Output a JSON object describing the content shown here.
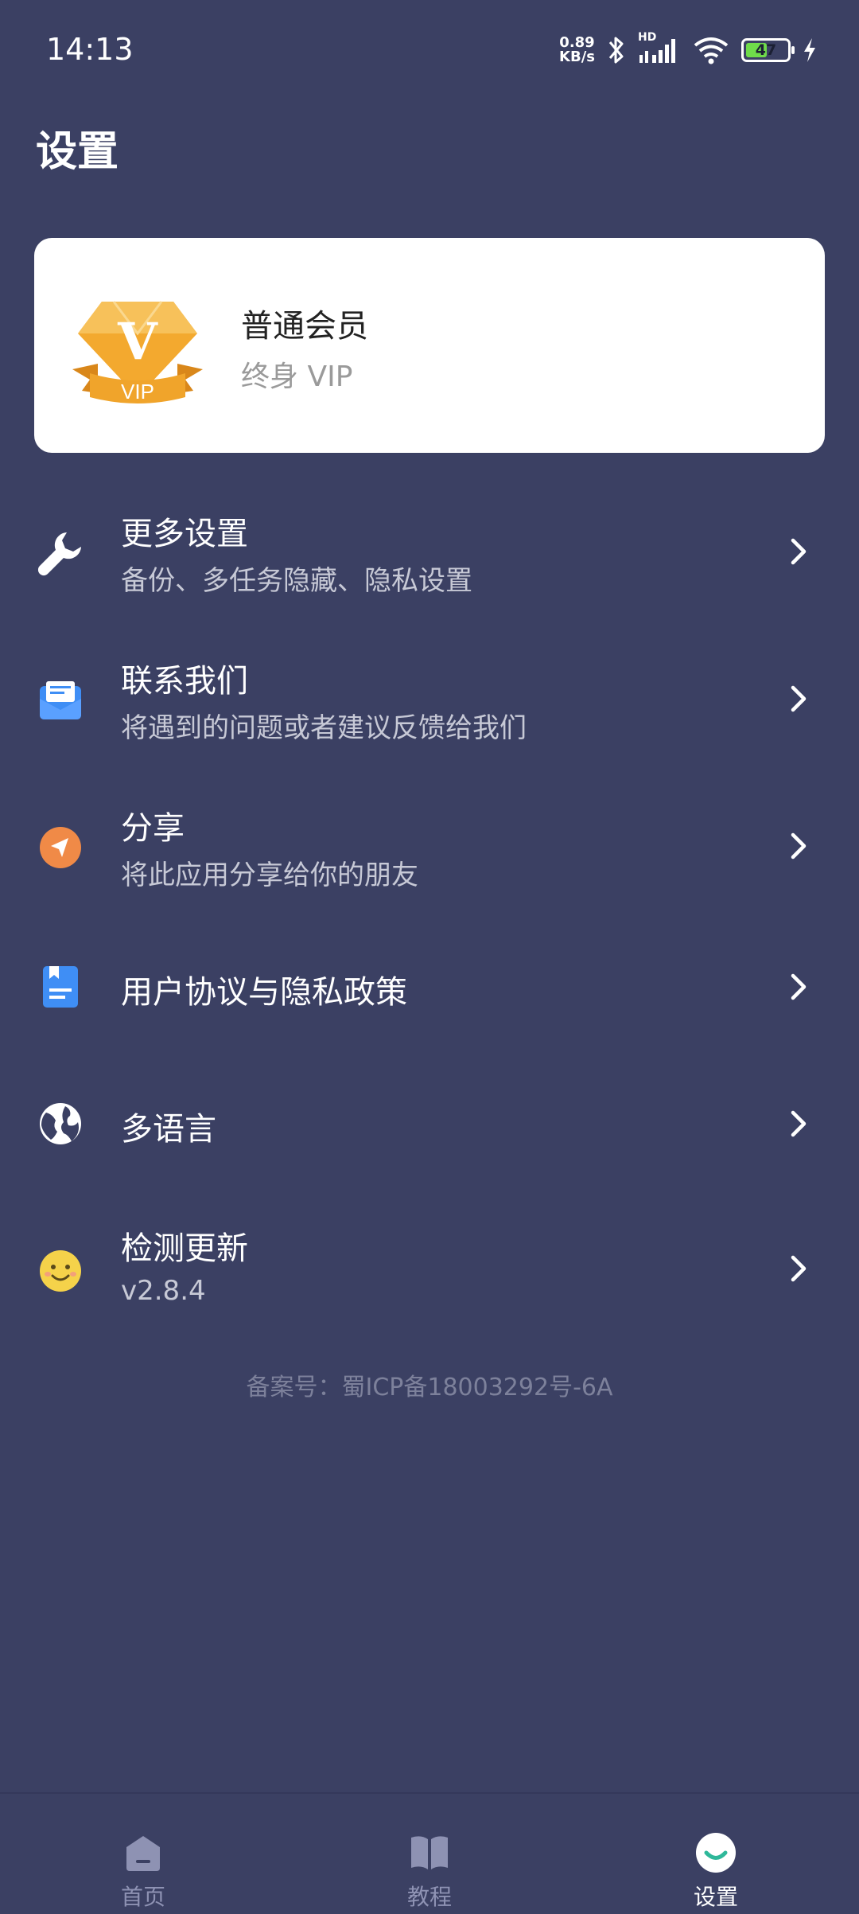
{
  "status_bar": {
    "time": "14:13",
    "net_speed_value": "0.89",
    "net_speed_unit": "KB/s",
    "network_label": "HD",
    "battery": "47"
  },
  "page": {
    "title": "设置"
  },
  "vip": {
    "title": "普通会员",
    "subtitle": "终身 VIP",
    "badge_letter": "V",
    "badge_text": "VIP"
  },
  "menu": [
    {
      "title": "更多设置",
      "subtitle": "备份、多任务隐藏、隐私设置",
      "icon": "wrench-icon"
    },
    {
      "title": "联系我们",
      "subtitle": "将遇到的问题或者建议反馈给我们",
      "icon": "mail-icon"
    },
    {
      "title": "分享",
      "subtitle": "将此应用分享给你的朋友",
      "icon": "share-icon"
    },
    {
      "title": "用户协议与隐私政策",
      "subtitle": "",
      "icon": "document-icon"
    },
    {
      "title": "多语言",
      "subtitle": "",
      "icon": "globe-icon"
    },
    {
      "title": "检测更新",
      "subtitle": "v2.8.4",
      "icon": "smiley-icon"
    }
  ],
  "footer": {
    "icp": "备案号：蜀ICP备18003292号-6A"
  },
  "tabbar": {
    "items": [
      {
        "label": "首页",
        "active": false
      },
      {
        "label": "教程",
        "active": false
      },
      {
        "label": "设置",
        "active": true
      }
    ]
  },
  "colors": {
    "background": "#3b4063",
    "card": "#ffffff",
    "accent_orange": "#f0a42b",
    "mail_blue": "#3f8ef5",
    "share_orange": "#f08a47",
    "smiley_yellow": "#f5d24a"
  }
}
